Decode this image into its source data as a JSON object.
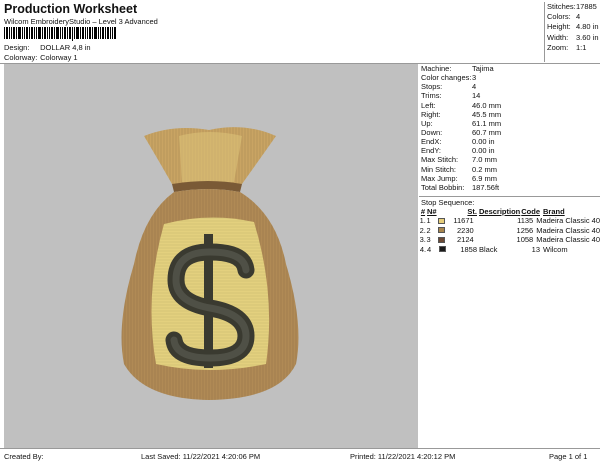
{
  "header": {
    "title": "Production Worksheet",
    "subtitle": "Wilcom EmbroideryStudio – Level 3 Advanced",
    "design_label": "Design:",
    "design_value": "DOLLAR 4,8 in",
    "colorway_label": "Colorway:",
    "colorway_value": "Colorway 1"
  },
  "summary": [
    {
      "label": "Stitches:",
      "value": "17885"
    },
    {
      "label": "Colors:",
      "value": "4"
    },
    {
      "label": "Height:",
      "value": "4.80 in"
    },
    {
      "label": "Width:",
      "value": "3.60 in"
    },
    {
      "label": "Zoom:",
      "value": "1:1"
    }
  ],
  "info": [
    {
      "label": "Machine:",
      "value": "Tajima"
    },
    {
      "label": "Color changes:",
      "value": "3"
    },
    {
      "label": "Stops:",
      "value": "4"
    },
    {
      "label": "Trims:",
      "value": "14"
    },
    {
      "label": "Left:",
      "value": "46.0 mm"
    },
    {
      "label": "Right:",
      "value": "45.5 mm"
    },
    {
      "label": "Up:",
      "value": "61.1 mm"
    },
    {
      "label": "Down:",
      "value": "60.7 mm"
    },
    {
      "label": "EndX:",
      "value": "0.00 in"
    },
    {
      "label": "EndY:",
      "value": "0.00 in"
    },
    {
      "label": "Max Stitch:",
      "value": "7.0 mm"
    },
    {
      "label": "Min Stitch:",
      "value": "0.2 mm"
    },
    {
      "label": "Max Jump:",
      "value": "6.9 mm"
    },
    {
      "label": "Total Bobbin:",
      "value": "187.56ft"
    }
  ],
  "stop_sequence": {
    "title": "Stop Sequence:",
    "headers": {
      "hash": "#",
      "n": "N#",
      "st": "St.",
      "desc": "Description",
      "code": "Code",
      "brand": "Brand"
    },
    "rows": [
      {
        "idx": "1.",
        "n": "1",
        "color": "#e6cd7a",
        "st": "11671",
        "desc": "",
        "code": "1135",
        "brand": "Madeira Classic 40"
      },
      {
        "idx": "2.",
        "n": "2",
        "color": "#a8864e",
        "st": "2230",
        "desc": "",
        "code": "1256",
        "brand": "Madeira Classic 40"
      },
      {
        "idx": "3.",
        "n": "3",
        "color": "#6b4a36",
        "st": "2124",
        "desc": "",
        "code": "1058",
        "brand": "Madeira Classic 40"
      },
      {
        "idx": "4.",
        "n": "4",
        "color": "#1a1a1a",
        "st": "1858",
        "desc": "Black",
        "code": "13",
        "brand": "Wilcom"
      }
    ]
  },
  "footer": {
    "created": "Created By:",
    "saved": "Last Saved: 11/22/2021 4:20:06 PM",
    "printed": "Printed: 11/22/2021 4:20:12 PM",
    "page": "Page 1 of 1"
  },
  "colors": {
    "canvas_bg": "#c0c0c0",
    "bag_gold": "#c9a463",
    "bag_tan": "#b08a55",
    "dollar_patch": "#e3d07e",
    "dollar_sign": "#3a3a30"
  }
}
